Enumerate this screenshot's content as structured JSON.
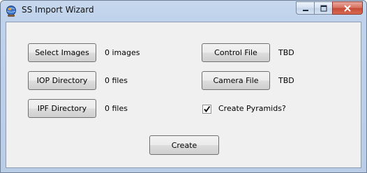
{
  "window": {
    "title": "SS Import Wizard",
    "icon": "globe-app-icon"
  },
  "caption_buttons": {
    "minimize_icon": "minimize-icon",
    "maximize_icon": "maximize-icon",
    "close_icon": "close-icon"
  },
  "left_column": {
    "select_images_label": "Select Images",
    "images_count": "0 images",
    "iop_directory_label": "IOP Directory",
    "iop_files_count": "0 files",
    "ipf_directory_label": "IPF Directory",
    "ipf_files_count": "0 files"
  },
  "right_column": {
    "control_file_label": "Control File",
    "control_file_value": "TBD",
    "camera_file_label": "Camera File",
    "camera_file_value": "TBD",
    "create_pyramids_label": "Create Pyramids?",
    "create_pyramids_checked": true
  },
  "footer": {
    "create_label": "Create"
  },
  "colors": {
    "title_bar": "#bed2eb",
    "client_bg": "#f0f0f0",
    "close_button": "#c54a36"
  }
}
